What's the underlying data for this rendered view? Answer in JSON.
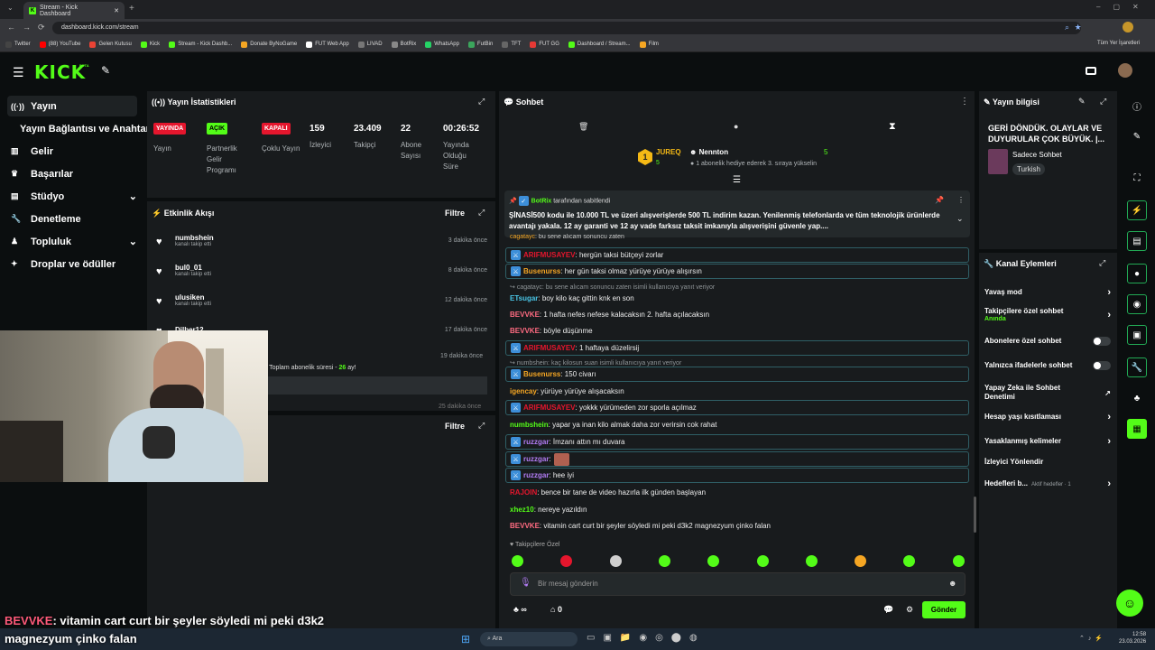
{
  "browser": {
    "tab_title": "Stream - Kick Dashboard",
    "url": "dashboard.kick.com/stream",
    "all_bookmarks": "Tüm Yer İşaretleri",
    "bookmarks": [
      {
        "label": "Twitter",
        "color": "#444"
      },
      {
        "label": "(88) YouTube",
        "color": "#ff0000"
      },
      {
        "label": "Gelen Kutusu",
        "color": "#ea4335"
      },
      {
        "label": "Kick",
        "color": "#53fc18"
      },
      {
        "label": "Stream - Kick Dashb...",
        "color": "#53fc18"
      },
      {
        "label": "Donate ByNoGame",
        "color": "#f5a623"
      },
      {
        "label": "FUT Web App",
        "color": "#fff"
      },
      {
        "label": "LIVAD",
        "color": "#777"
      },
      {
        "label": "BotRix",
        "color": "#888"
      },
      {
        "label": "WhatsApp",
        "color": "#25d366"
      },
      {
        "label": "FutBin",
        "color": "#3ba55c"
      },
      {
        "label": "TFT",
        "color": "#666"
      },
      {
        "label": "FUT GG",
        "color": "#e53935"
      },
      {
        "label": "Dashboard / Stream...",
        "color": "#53fc18"
      },
      {
        "label": "Film",
        "color": "#f5a623"
      }
    ]
  },
  "app": {
    "logo": "KICK",
    "beta": "BETA",
    "accent": "#53fc18"
  },
  "sidebar": {
    "items": [
      {
        "label": "Yayın",
        "icon": "broadcast-icon",
        "selected": true
      },
      {
        "label": "Yayın Bağlantısı ve Anahtarı",
        "icon": ""
      },
      {
        "label": "Gelir",
        "icon": "chart-icon"
      },
      {
        "label": "Başarılar",
        "icon": "trophy-icon"
      },
      {
        "label": "Stüdyo",
        "icon": "studio-icon",
        "chevron": true
      },
      {
        "label": "Denetleme",
        "icon": "wrench-icon"
      },
      {
        "label": "Topluluk",
        "icon": "users-icon",
        "chevron": true
      },
      {
        "label": "Droplar ve ödüller",
        "icon": "gift-icon"
      }
    ]
  },
  "stats": {
    "title": "Yayın İstatistikleri",
    "items": [
      {
        "badge": "YAYINDA",
        "badge_bg": "#e5162d",
        "badge_fg": "#fff",
        "label": "Yayın"
      },
      {
        "badge": "AÇIK",
        "badge_bg": "#53fc18",
        "badge_fg": "#000",
        "label": "Partnerlik Gelir Programı"
      },
      {
        "badge": "KAPALI",
        "badge_bg": "#e5162d",
        "badge_fg": "#fff",
        "label": "Çoklu Yayın"
      },
      {
        "value": "159",
        "label": "İzleyici"
      },
      {
        "value": "23.409",
        "label": "Takipçi"
      },
      {
        "value": "22",
        "label": "Abone Sayısı"
      },
      {
        "value": "00:26:52",
        "label": "Yayında Olduğu Süre"
      }
    ]
  },
  "activity": {
    "title": "Etkinlik Akışı",
    "filter": "Filtre",
    "items": [
      {
        "name": "numbshein",
        "sub": "kanalı takip etti",
        "time": "3 dakika önce"
      },
      {
        "name": "bul0_01",
        "sub": "kanalı takip etti",
        "time": "8 dakika önce"
      },
      {
        "name": "ulusiken",
        "sub": "kanalı takip etti",
        "time": "12 dakika önce"
      },
      {
        "name": "Dilber12",
        "sub": "",
        "time": "17 dakika önce"
      }
    ],
    "sub_time": "19 dakika önce",
    "sub_text": "r! Toplam abonelik süresi -",
    "sub_months": "26",
    "sub_tail": "ay!",
    "more_time": "25 dakika önce"
  },
  "panel3": {
    "filter": "Filtre"
  },
  "chat": {
    "title": "Sohbet",
    "leader1": {
      "name": "JUREQ",
      "count": "5"
    },
    "leader2": {
      "name": "Nennton",
      "count": "5",
      "sub": "1 abonelik hediye ederek 3. sıraya yükselin"
    },
    "pinned": {
      "by": "BotRix",
      "by_suffix": "tarafından sabitlendi",
      "text": "ŞİNASİ500 kodu ile 10.000 TL ve üzeri alışverişlerde 500 TL indirim kazan.  Yenilenmiş telefonlarda ve tüm teknolojik ürünlerde avantajı yakala. 12 ay garanti ve 12 ay vade farksız taksit imkanıyla alışverişini güvenle yap...."
    },
    "clipped": {
      "user": "cagatayc",
      "text": "bu sene alıcam sonuncu zaten"
    },
    "messages": [
      {
        "user": "ARIFMUSAYEV",
        "color": "#e5162d",
        "text": ": hergün taksi bütçeyi zorlar",
        "mod": true,
        "box": true
      },
      {
        "user": "Busenurss",
        "color": "#f5a623",
        "text": ": her gün taksi olmaz yürüye yürüye alışırsın",
        "mod": true,
        "box": true
      },
      {
        "reply": "cagatayc: bu sene alıcam sonuncu zaten isimli kullanıcıya yanıt veriyor"
      },
      {
        "user": "ETsugar",
        "color": "#49c5e6",
        "text": ": boy kilo kaç gittin knk en son"
      },
      {
        "user": "BEVVKE",
        "color": "#ff6b81",
        "text": ": 1 hafta nefes nefese kalacaksın 2. hafta açılacaksın"
      },
      {
        "user": "BEVVKE",
        "color": "#ff6b81",
        "text": ": böyle düşünme"
      },
      {
        "user": "ARIFMUSAYEV",
        "color": "#e5162d",
        "text": ": 1 haftaya düzelirsij",
        "mod": true,
        "box": true
      },
      {
        "reply": "numbshein: kaç kilosun suan isimli kullanıcıya yanıt veriyor"
      },
      {
        "user": "Busenurss",
        "color": "#f5a623",
        "text": ": 150 civarı",
        "mod": true,
        "box": true
      },
      {
        "user": "igencay",
        "color": "#f5a623",
        "text": ": yürüye yürüye alışacaksın"
      },
      {
        "user": "ARIFMUSAYEV",
        "color": "#e5162d",
        "text": ": yokkk yürümeden zor sporla açılmaz",
        "mod": true,
        "box": true
      },
      {
        "user": "numbshein",
        "color": "#53fc18",
        "text": ": yapar ya inan kilo almak daha zor verirsin cok rahat"
      },
      {
        "user": "ruzzgar",
        "color": "#b37cf5",
        "text": ": İmzanı attın mı duvara",
        "mod": true,
        "box": true
      },
      {
        "user": "ruzzgar",
        "color": "#b37cf5",
        "text": ":",
        "mod": true,
        "box": true,
        "emote": true
      },
      {
        "user": "ruzzgar",
        "color": "#b37cf5",
        "text": ": hee iyi",
        "mod": true,
        "box": true
      },
      {
        "user": "RAJOIN",
        "color": "#e5162d",
        "text": ": bence bir tane de video hazırla ilk günden başlayan"
      },
      {
        "user": "xhez10",
        "color": "#53fc18",
        "text": ": nereye yazıldın"
      },
      {
        "user": "BEVVKE",
        "color": "#ff6b81",
        "text": ": vitamin cart curt bir şeyler söyledi mi peki d3k2 magnezyum çinko falan"
      }
    ],
    "followers_only": "Takipçilere Özel",
    "placeholder": "Bir mesaj gönderin",
    "infinity": "∞",
    "zero": "0",
    "send": "Gönder"
  },
  "info": {
    "title": "Yayın bilgisi",
    "stream_title": "GERİ DÖNDÜK. OLAYLAR VE DUYURULAR ÇOK BÜYÜK. |...",
    "category": "Sadece Sohbet",
    "language": "Turkish"
  },
  "actions": {
    "title": "Kanal Eylemleri",
    "items": [
      {
        "label": "Yavaş mod",
        "kind": "arrow"
      },
      {
        "label": "Takipçilere özel sohbet",
        "sub": "Anında",
        "kind": "arrow"
      },
      {
        "label": "Abonelere özel sohbet",
        "kind": "toggle"
      },
      {
        "label": "Yalnızca ifadelerle sohbet",
        "kind": "toggle"
      },
      {
        "label": "Yapay Zeka ile Sohbet Denetimi",
        "kind": "ext"
      },
      {
        "label": "Hesap yaşı kısıtlaması",
        "kind": "arrow"
      },
      {
        "label": "Yasaklanmış kelimeler",
        "kind": "arrow"
      },
      {
        "label": "İzleyici Yönlendir",
        "kind": "none"
      },
      {
        "label": "Hedefleri b...",
        "sub": "Aktif hedefler · 1",
        "kind": "arrow"
      }
    ]
  },
  "overlay": {
    "user": "BEVVKE",
    "text": ": vitamin cart curt bir şeyler söyledi mi peki d3k2",
    "text2": "magnezyum çinko falan"
  },
  "taskbar": {
    "search": "Ara",
    "time": "12:58",
    "date": "23.03.2026"
  }
}
